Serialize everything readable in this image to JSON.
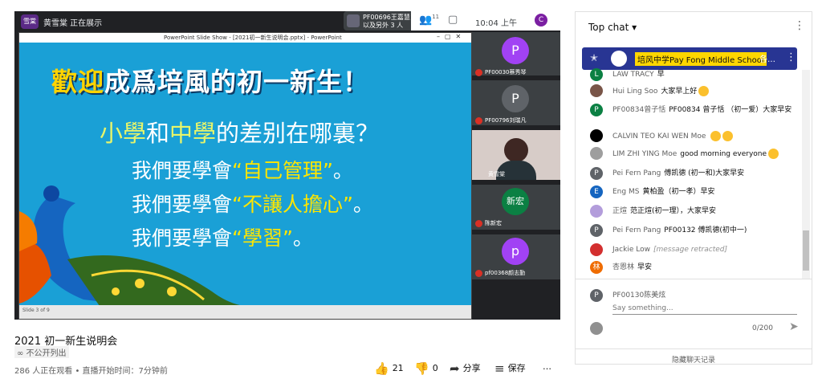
{
  "meet": {
    "presenter_badge": "雪棠",
    "presenting_text": "黄雪棠 正在展示",
    "pill_name": "PF00696王嘉慧",
    "pill_others": "以及另外 3 人",
    "people_count": "11",
    "time": "10:04 上午",
    "user_initial": "C"
  },
  "ppt": {
    "window_title": "PowerPoint Slide Show - [2021初一新生说明会.pptx] - PowerPoint",
    "status": "Slide 3 of 9"
  },
  "slide": {
    "title_yellow": "歡迎",
    "title_white": "成爲培風的初一新生！",
    "q_a": "小學",
    "q_b": "和",
    "q_c": "中學",
    "q_d": "的差别在哪裏？",
    "line1_a": "我們要學會",
    "line1_b": "“自己管理”",
    "line1_c": "。",
    "line2_a": "我們要學會",
    "line2_b": "“不讓人擔心”",
    "line2_c": "。",
    "line3_a": "我們要學會",
    "line3_b": "“學習”",
    "line3_c": "。"
  },
  "tiles": [
    {
      "initial": "P",
      "name": "PF00030蔡秀琴",
      "color": "#a142f4"
    },
    {
      "initial": "P",
      "name": "PF00796刘瑞凡",
      "color": "#5f6368"
    },
    {
      "initial": "",
      "name": "黄雪棠",
      "color": "#8d6e63"
    },
    {
      "initial": "新宏",
      "name": "陈新宏",
      "color": "#0b8043"
    },
    {
      "initial": "p",
      "name": "pf00368颜志勤",
      "color": "#a142f4"
    }
  ],
  "video": {
    "title": "2021 初一新生说明会",
    "unlisted": "不公开列出",
    "stats": "286 人正在观看 • 直播开始时间：7分钟前",
    "likes": "21",
    "dislikes": "0",
    "share": "分享",
    "save": "保存",
    "more": "…"
  },
  "chat": {
    "header": "Top chat",
    "pinned_badge": "培风中学Pay Fong Middle School",
    "pinned_more": "各…",
    "messages": [
      {
        "initial": "L",
        "author": "LAW TRACY",
        "text": "早",
        "color": "#0b8043"
      },
      {
        "initial": "",
        "author": "Hui Ling Soo",
        "text": "大家早上好",
        "color": "#795548",
        "emoji": 1
      },
      {
        "initial": "P",
        "author": "PF00834曾子恬",
        "text": "PF00834 曾子恬 （初一爱）大家早安",
        "color": "#0b8043"
      },
      {
        "initial": "",
        "author": "CALVIN TEO KAI WEN Moe",
        "text": "",
        "color": "#000000",
        "emoji": 2
      },
      {
        "initial": "",
        "author": "LIM ZHI YING Moe",
        "text": "good morning everyone",
        "color": "#9e9e9e",
        "emoji": 1
      },
      {
        "initial": "P",
        "author": "Pei Fern Pang",
        "text": "傅凯德 (初一和)大家早安",
        "color": "#5f6368"
      },
      {
        "initial": "E",
        "author": "Eng MS",
        "text": "黄柏盈（初一孝）早安",
        "color": "#1565c0"
      },
      {
        "initial": "",
        "author": "正煊",
        "text": "范正煊(初一理），大家早安",
        "color": "#b39ddb"
      },
      {
        "initial": "P",
        "author": "Pei Fern Pang",
        "text": "PF00132 傅凯德(初中一)",
        "color": "#5f6368"
      },
      {
        "initial": "",
        "author": "Jackie Low",
        "text": "[message retracted]",
        "color": "#d32f2f",
        "retracted": true
      },
      {
        "initial": "林",
        "author": "杏恩林",
        "text": "早安",
        "color": "#ef6c00"
      }
    ],
    "input_name": "PF00130陈美炫",
    "input_placeholder": "Say something...",
    "input_initial": "P",
    "counter": "0/200",
    "hide": "隐藏聊天记录"
  }
}
